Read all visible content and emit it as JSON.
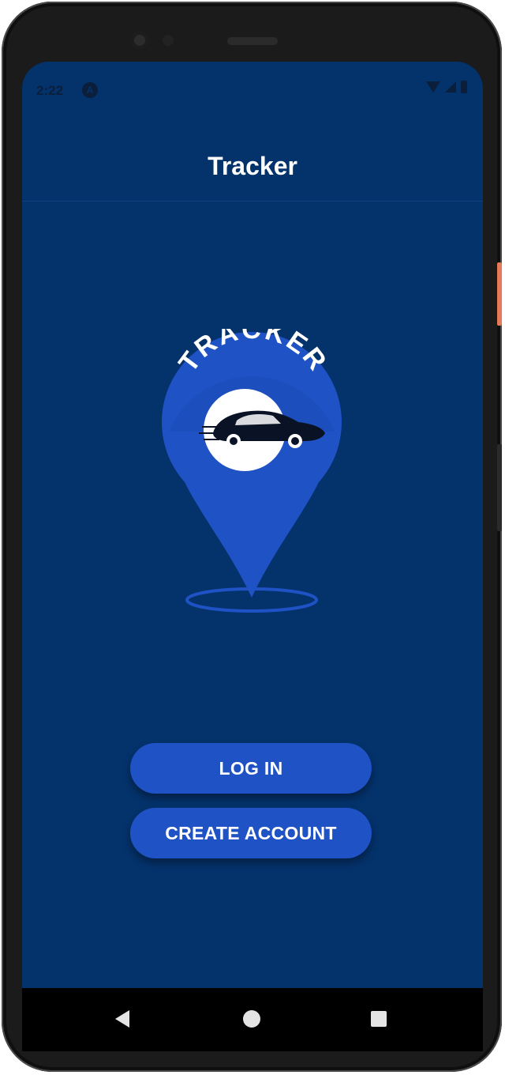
{
  "status_bar": {
    "time": "2:22",
    "notification_icon": "A"
  },
  "app_bar": {
    "title": "Tracker"
  },
  "logo": {
    "text": "TRACKER"
  },
  "actions": {
    "login_label": "LOG IN",
    "create_account_label": "CREATE ACCOUNT"
  },
  "nav_bar": {
    "icons": [
      "back-icon",
      "home-icon",
      "recents-icon"
    ]
  },
  "colors": {
    "background": "#04326b",
    "button": "#1f52c4",
    "logo_pin": "#1f52c4",
    "text": "#ffffff"
  }
}
